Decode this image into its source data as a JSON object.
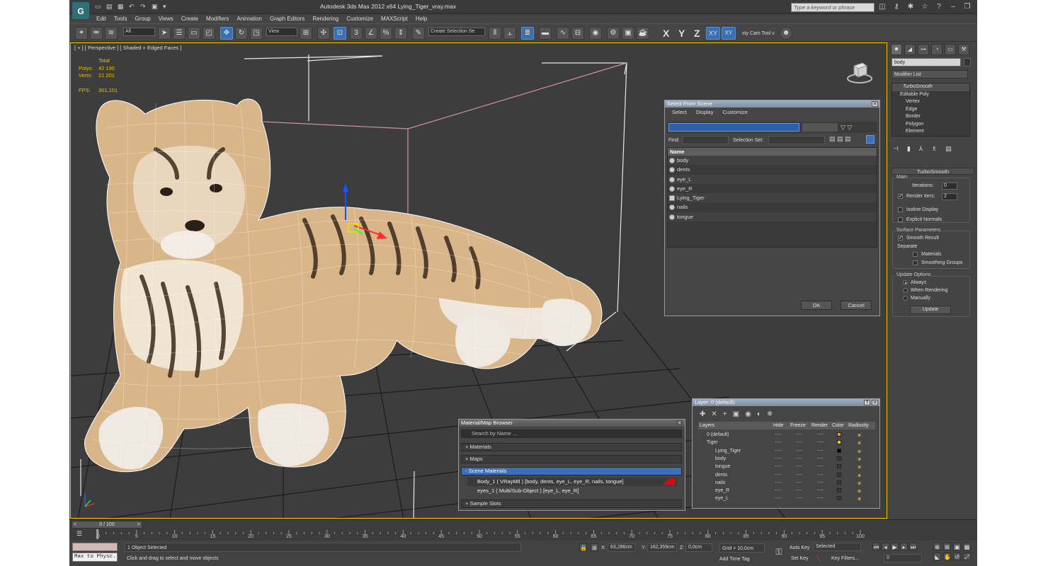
{
  "window": {
    "title": "Autodesk 3ds Max  2012 x64     Lying_Tiger_vray.max",
    "search_placeholder": "Type a keyword or phrase"
  },
  "menu": [
    "Edit",
    "Tools",
    "Group",
    "Views",
    "Create",
    "Modifiers",
    "Animation",
    "Graph Editors",
    "Rendering",
    "Customize",
    "MAXScript",
    "Help"
  ],
  "toolbar": {
    "filter": "All",
    "ref_coord": "View",
    "named_selection": "Create Selection Se",
    "axes": [
      "X",
      "Y",
      "Z",
      "XY"
    ],
    "xy_sub": "XY",
    "camera_tool": "sty Cam Tool v"
  },
  "viewport": {
    "label": "[ + ] [ Perspective ] [ Shaded + Edged Faces ]",
    "stats_header": "Total",
    "polys_label": "Polys:",
    "polys_value": "42 190",
    "verts_label": "Verts:",
    "verts_value": "21 201",
    "fps_label": "FPS:",
    "fps_value": "301,101"
  },
  "select_from_scene": {
    "title": "Select From Scene",
    "menu": [
      "Select",
      "Display",
      "Customize"
    ],
    "find_label": "Find:",
    "selection_set_label": "Selection Set:",
    "column_name": "Name",
    "items": [
      "body",
      "dents",
      "eye_L",
      "eye_R",
      "Lying_Tiger",
      "nails",
      "tongue"
    ],
    "ok": "OK",
    "cancel": "Cancel"
  },
  "material_browser": {
    "title": "Material/Map Browser",
    "search": "Search by Name ...",
    "sections": [
      "+ Materials",
      "+ Maps",
      "- Scene Materials",
      "+ Sample Slots"
    ],
    "scene_materials": [
      "Body_1  ( VRayMtl ) [body, dents, eye_L, eye_R, nails, tongue]",
      "eyes_1  ( Multi/Sub-Object ) [eye_L, eye_R]"
    ]
  },
  "layer_dialog": {
    "title": "Layer: 0 (default)",
    "help": "?",
    "columns": [
      "Layers",
      "Hide",
      "Freeze",
      "Render",
      "Color",
      "Radiosity"
    ],
    "rows": [
      {
        "name": "0 (default)",
        "color": "#e89a3a"
      },
      {
        "name": "Tiger",
        "color": "#e8d020"
      },
      {
        "name": "Lying_Tiger",
        "color": "#000000"
      },
      {
        "name": "body",
        "color": "#3a3a3a"
      },
      {
        "name": "tongue",
        "color": "#3a3a3a"
      },
      {
        "name": "dents",
        "color": "#3a3a3a"
      },
      {
        "name": "nails",
        "color": "#3a3a3a"
      },
      {
        "name": "eye_R",
        "color": "#3a3a3a"
      },
      {
        "name": "eye_L",
        "color": "#3a3a3a"
      }
    ],
    "dash": "----"
  },
  "command_panel": {
    "name_field": "body",
    "modifier_list": "Modifier List",
    "stack": [
      "TurboSmooth",
      "Editable Poly",
      "Vertex",
      "Edge",
      "Border",
      "Polygon",
      "Element"
    ],
    "rollout_title": "TurboSmooth",
    "main_label": "Main",
    "iterations_label": "Iterations:",
    "iterations_value": "0",
    "render_iters_label": "Render Iters:",
    "render_iters_value": "2",
    "isoline": "Isoline Display",
    "explicit_normals": "Explicit Normals",
    "surface_params": "Surface Parameters",
    "smooth_result": "Smooth Result",
    "separate": "Separate",
    "materials": "Materials",
    "smoothing_groups": "Smoothing Groups",
    "update_options": "Update Options",
    "always": "Always",
    "when_rendering": "When Rendering",
    "manually": "Manually",
    "update": "Update"
  },
  "timeline": {
    "slider": "0 / 100",
    "ticks": [
      "0",
      "5",
      "10",
      "15",
      "20",
      "25",
      "30",
      "35",
      "40",
      "45",
      "50",
      "55",
      "60",
      "65",
      "70",
      "75",
      "80",
      "85",
      "90",
      "95",
      "100"
    ]
  },
  "status": {
    "maxscript": "Max to Physc.",
    "selected": "1 Object Selected",
    "prompt": "Click and drag to select and move objects",
    "x_label": "X:",
    "x_value": "63,286cm",
    "y_label": "Y:",
    "y_value": "162,359cm",
    "z_label": "Z:",
    "z_value": "0,0cm",
    "grid": "Grid = 10,0cm",
    "add_time_tag": "Add Time Tag",
    "auto_key": "Auto Key",
    "set_key": "Set Key",
    "selected_combo": "Selected",
    "key_filters": "Key Filters...",
    "frame": "0"
  },
  "colors": {
    "active_viewport_border": "#f0c000",
    "selection_highlight": "#3d6fb8",
    "stats_text": "#e8c000"
  }
}
